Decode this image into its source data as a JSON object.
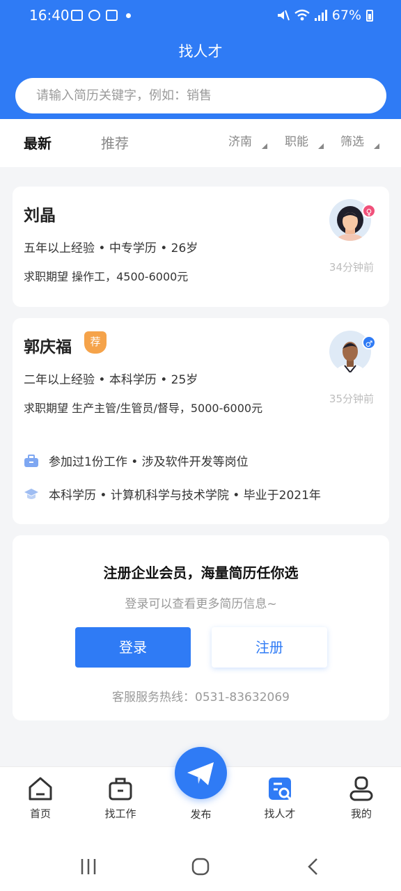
{
  "status": {
    "time": "16:40",
    "battery": "67%"
  },
  "header": {
    "title": "找人才",
    "search_placeholder": "请输入简历关键字，例如：销售"
  },
  "tabs": {
    "latest": "最新",
    "recommend": "推荐"
  },
  "filters": {
    "city": "济南",
    "function": "职能",
    "filter": "筛选"
  },
  "candidates": [
    {
      "name": "刘晶",
      "meta": "五年以上经验  •  中专学历  •  26岁",
      "expect": "求职期望 操作工，4500-6000元",
      "time": "34分钟前",
      "gender_color": "#f0507a"
    },
    {
      "name": "郭庆福",
      "badge": "荐",
      "meta": "二年以上经验  •  本科学历  •  25岁",
      "expect": "求职期望 生产主管/生管员/督导，5000-6000元",
      "time": "35分钟前",
      "work": "参加过1份工作  •  涉及软件开发等岗位",
      "edu": "本科学历  •  计算机科学与技术学院  •  毕业于2021年",
      "gender_color": "#2f7bf5"
    }
  ],
  "member": {
    "title": "注册企业会员，海量简历任你选",
    "subtitle": "登录可以查看更多简历信息~",
    "login": "登录",
    "register": "注册",
    "hotline": "客服服务热线：0531-83632069"
  },
  "nav": {
    "home": "首页",
    "jobs": "找工作",
    "publish": "发布",
    "talent": "找人才",
    "mine": "我的"
  },
  "colors": {
    "primary": "#2f7bf5",
    "badge": "#f5a34a"
  }
}
